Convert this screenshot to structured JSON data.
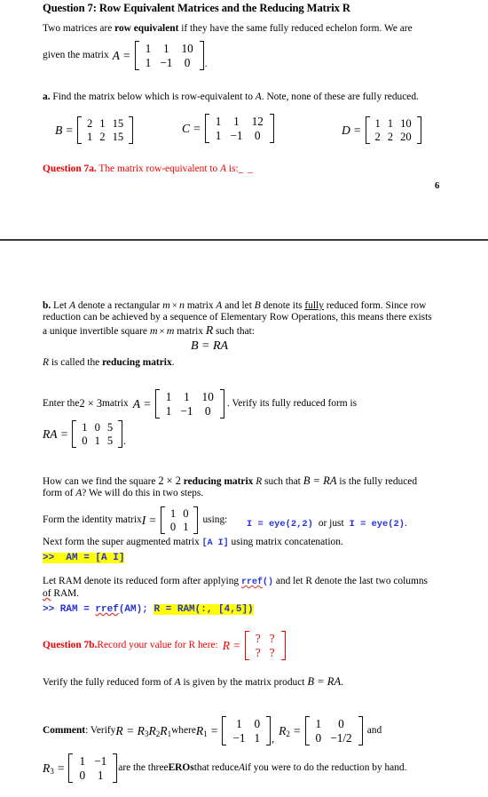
{
  "document": {
    "title": "Question 7: Row Equivalent Matrices and the Reducing Matrix R",
    "page_number": "6"
  },
  "intro": {
    "line1_a": " Two matrices are ",
    "line1_bold": "row equivalent",
    "line1_b": " if they have the same fully reduced echelon form. We are",
    "line2": "given the matrix",
    "A_label": "A",
    "equals": "=",
    "period": "."
  },
  "part_a": {
    "marker": "a.",
    "text_1": " Find the matrix below which is row-equivalent to ",
    "var_A": "A",
    "text_2": ". Note, none of these are fully reduced.",
    "matrices": [
      {
        "name": "B",
        "rows": [
          [
            "2",
            "1",
            "15"
          ],
          [
            "1",
            "2",
            "15"
          ]
        ]
      },
      {
        "name": "C",
        "rows": [
          [
            "1",
            "1",
            "12"
          ],
          [
            "1",
            "−1",
            "0"
          ]
        ]
      },
      {
        "name": "D",
        "rows": [
          [
            "1",
            "1",
            "10"
          ],
          [
            "2",
            "2",
            "20"
          ]
        ]
      }
    ],
    "question_label": "Question 7a.",
    "question_text": " The matrix row-equivalent to ",
    "question_var": "A",
    "question_tail": " is:",
    "answer_blank": "_ _"
  },
  "part_b": {
    "marker": "b.",
    "para1_seg1": " Let ",
    "para1_var1": "A",
    "para1_seg2": " denote a rectangular ",
    "para1_m": "m",
    "para1_times": "×",
    "para1_n": "n",
    "para1_seg3": " matrix ",
    "para1_var2": "A",
    "para1_seg4": " and let ",
    "para1_var3": "B",
    "para1_seg5": " denote its ",
    "para1_underline": "fully",
    "para1_seg6": " reduced form. Since row",
    "para2": "reduction can be achieved by a sequence of Elementary Row Operations, this means there exists",
    "para3_seg1": "a unique invertible square ",
    "para3_m1": "m",
    "para3_times": "×",
    "para3_m2": "m",
    "para3_seg2": " matrix ",
    "para3_R": "R",
    "para3_seg3": " such that:",
    "display_eq": "B = RA",
    "reducing_seg1": "R",
    "reducing_seg2": " is called the ",
    "reducing_bold": "reducing matrix",
    "reducing_seg3": ".",
    "enter_seg1": "Enter the ",
    "enter_dim": "2 × 3",
    "enter_seg2": " matrix",
    "enter_var": "A",
    "enter_eq": "=",
    "enter_matrix": {
      "rows": [
        [
          "1",
          "1",
          "10"
        ],
        [
          "1",
          "−1",
          "0"
        ]
      ]
    },
    "enter_tail": ". Verify its fully reduced form is",
    "ra_label": "RA",
    "ra_eq": "=",
    "ra_matrix": {
      "rows": [
        [
          "1",
          "0",
          "5"
        ],
        [
          "0",
          "1",
          "5"
        ]
      ]
    },
    "ra_period": ".",
    "how_seg1": "How can we find the square ",
    "how_dim": "2 × 2",
    "how_bold": "reducing matrix",
    "how_R": "R",
    "how_seg2": " such that ",
    "how_eq": "B = RA",
    "how_seg3": " is the fully reduced",
    "how_line2_seg1": "form of ",
    "how_line2_var": "A",
    "how_line2_seg2": "? We will do this in two steps.",
    "form_seg1": "Form the identity matrix ",
    "form_I": "I",
    "form_eq": "=",
    "identity_matrix": {
      "rows": [
        [
          "1",
          "0"
        ],
        [
          "0",
          "1"
        ]
      ]
    },
    "form_using": "using:",
    "code_eye_1": "I = eye(2,2)",
    "code_orjust": "or just",
    "code_eye_2": "I = eye(2)",
    "code_eye_period": ".",
    "next_seg1": "Next form the super augmented matrix ",
    "next_code": "[A I]",
    "next_seg2": " using matrix concatenation.",
    "cmd_am": ">>  AM = [A I]",
    "ram_seg1": "Let RAM denote its reduced form after applying ",
    "ram_code_rref": "rref",
    "ram_code_parens": "()",
    "ram_seg2": " and let R denote the last two columns",
    "ram_line2_a": "of",
    "ram_line2_b": " RAM.",
    "cmd_ram_prefix": ">> RAM = ",
    "cmd_ram_rref": "rref",
    "cmd_ram_mid": "(AM); ",
    "cmd_ram_hl": "R = RAM(:, [4,5])",
    "question_label": "Question 7b.",
    "question_text": " Record your value for R here:",
    "question_R": "R",
    "question_eq": "=",
    "question_matrix": {
      "rows": [
        [
          "?",
          "?"
        ],
        [
          "?",
          "?"
        ]
      ]
    },
    "verify_seg1": "Verify the fully reduced form of ",
    "verify_var": "A",
    "verify_seg2": " is given by the matrix product ",
    "verify_eq": "B = RA",
    "verify_period": "."
  },
  "comment": {
    "label": "Comment",
    "colon": ": Verify ",
    "eq_R": "R = R",
    "eq_sub3": "3",
    "eq_R2": "R",
    "eq_sub2": "2",
    "eq_R1": "R",
    "eq_sub1": "1",
    "where": " where ",
    "R1_label": "R",
    "R1_sub": "1",
    "R1_eq": "=",
    "R1_matrix": {
      "rows": [
        [
          "1",
          "0"
        ],
        [
          "−1",
          "1"
        ]
      ]
    },
    "comma": ",",
    "R2_label": "R",
    "R2_sub": "2",
    "R2_eq": "=",
    "R2_matrix": {
      "rows": [
        [
          "1",
          "0"
        ],
        [
          "0",
          "−1/2"
        ]
      ]
    },
    "and": "and",
    "R3_label": "R",
    "R3_sub": "3",
    "R3_eq": "=",
    "R3_matrix": {
      "rows": [
        [
          "1",
          "−1"
        ],
        [
          "0",
          "1"
        ]
      ]
    },
    "tail_seg1": " are the three ",
    "tail_bold": "EROs",
    "tail_seg2": " that reduce ",
    "tail_var": "A",
    "tail_seg3": " if you were to do the reduction by hand."
  },
  "colors": {
    "code_blue": "#2432d8",
    "highlight_yellow": "#ffff00",
    "question_red": "#ee0000",
    "spellcheck_red": "#e03030"
  }
}
